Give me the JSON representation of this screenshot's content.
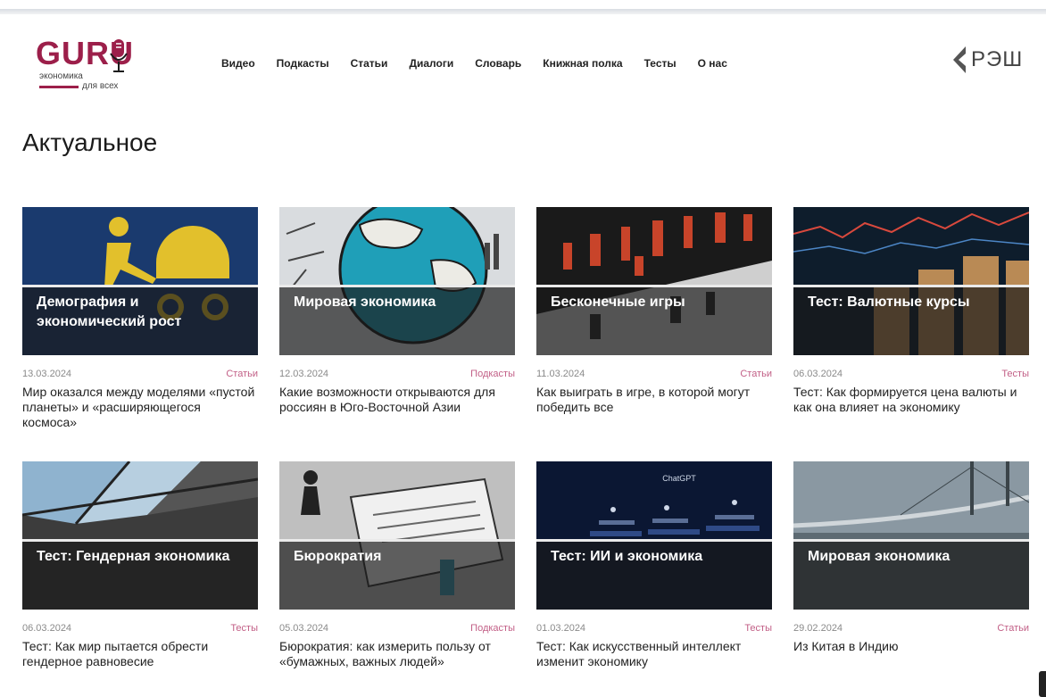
{
  "brand": {
    "logo_main": "GURU",
    "logo_line1": "экономика",
    "logo_line2": "для всех",
    "accent": "#9c1f4a",
    "partner_logo_text": "РЭШ"
  },
  "nav": [
    {
      "label": "Видео"
    },
    {
      "label": "Подкасты"
    },
    {
      "label": "Статьи"
    },
    {
      "label": "Диалоги"
    },
    {
      "label": "Словарь"
    },
    {
      "label": "Книжная полка"
    },
    {
      "label": "Тесты"
    },
    {
      "label": "О нас"
    }
  ],
  "section_title": "Актуальное",
  "cards": [
    {
      "title": "Демография и экономический рост",
      "date": "13.03.2024",
      "category": "Статьи",
      "description": "Мир оказался между моделями «пустой планеты» и «расширяющегося космоса»"
    },
    {
      "title": "Мировая экономика",
      "date": "12.03.2024",
      "category": "Подкасты",
      "description": "Какие возможности открываются для россиян в Юго-Восточной Азии"
    },
    {
      "title": "Бесконечные игры",
      "date": "11.03.2024",
      "category": "Статьи",
      "description": "Как выиграть в игре, в которой могут победить все"
    },
    {
      "title": "Тест: Валютные курсы",
      "date": "06.03.2024",
      "category": "Тесты",
      "description": "Тест: Как формируется цена валюты и как она влияет на экономику"
    },
    {
      "title": "Тест: Гендерная экономика",
      "date": "06.03.2024",
      "category": "Тесты",
      "description": "Тест: Как мир пытается обрести гендерное равновесие"
    },
    {
      "title": "Бюрократия",
      "date": "05.03.2024",
      "category": "Подкасты",
      "description": "Бюрократия: как измерить пользу от «бумажных, важных людей»"
    },
    {
      "title": "Тест: ИИ и экономика",
      "date": "01.03.2024",
      "category": "Тесты",
      "description": "Тест: Как искусственный интеллект изменит экономику",
      "image_text": "ChatGPT"
    },
    {
      "title": "Мировая экономика",
      "date": "29.02.2024",
      "category": "Статьи",
      "description": "Из Китая в Индию"
    }
  ]
}
